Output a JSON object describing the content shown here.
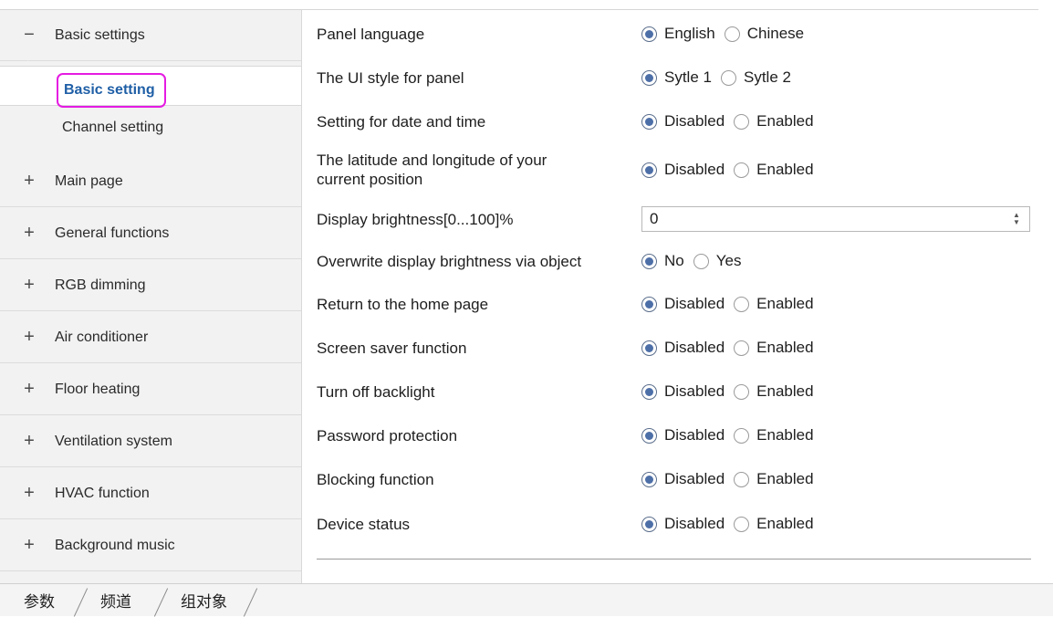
{
  "sidebar": {
    "groups": [
      {
        "symbol": "−",
        "label": "Basic settings"
      },
      {
        "symbol": "+",
        "label": "Main page"
      },
      {
        "symbol": "+",
        "label": "General functions"
      },
      {
        "symbol": "+",
        "label": "RGB dimming"
      },
      {
        "symbol": "+",
        "label": "Air conditioner"
      },
      {
        "symbol": "+",
        "label": "Floor heating"
      },
      {
        "symbol": "+",
        "label": "Ventilation system"
      },
      {
        "symbol": "+",
        "label": "HVAC function"
      },
      {
        "symbol": "+",
        "label": "Background music"
      }
    ],
    "subitems": [
      {
        "label": "Basic setting",
        "selected": true
      },
      {
        "label": "Channel setting",
        "selected": false
      }
    ],
    "highlight_color": "#e51be2"
  },
  "params": [
    {
      "label": "Panel language",
      "options": [
        "English",
        "Chinese"
      ],
      "selected": 0
    },
    {
      "label": "The UI style for panel",
      "options": [
        "Sytle 1",
        "Sytle 2"
      ],
      "selected": 0
    },
    {
      "label": "Setting for date and time",
      "options": [
        "Disabled",
        "Enabled"
      ],
      "selected": 0
    },
    {
      "label": "The latitude and longitude of your current position",
      "options": [
        "Disabled",
        "Enabled"
      ],
      "selected": 0
    },
    {
      "label": "Display brightness[0...100]%",
      "value": "0"
    },
    {
      "label": "Overwrite display brightness via object",
      "options": [
        "No",
        "Yes"
      ],
      "selected": 0
    },
    {
      "label": "Return to the home page",
      "options": [
        "Disabled",
        "Enabled"
      ],
      "selected": 0
    },
    {
      "label": "Screen saver function",
      "options": [
        "Disabled",
        "Enabled"
      ],
      "selected": 0
    },
    {
      "label": "Turn off backlight",
      "options": [
        "Disabled",
        "Enabled"
      ],
      "selected": 0
    },
    {
      "label": "Password protection",
      "options": [
        "Disabled",
        "Enabled"
      ],
      "selected": 0
    },
    {
      "label": "Blocking function",
      "options": [
        "Disabled",
        "Enabled"
      ],
      "selected": 0
    },
    {
      "label": "Device status",
      "options": [
        "Disabled",
        "Enabled"
      ],
      "selected": 0
    }
  ],
  "bottom_tabs": [
    "参数",
    "频道",
    "组对象"
  ]
}
